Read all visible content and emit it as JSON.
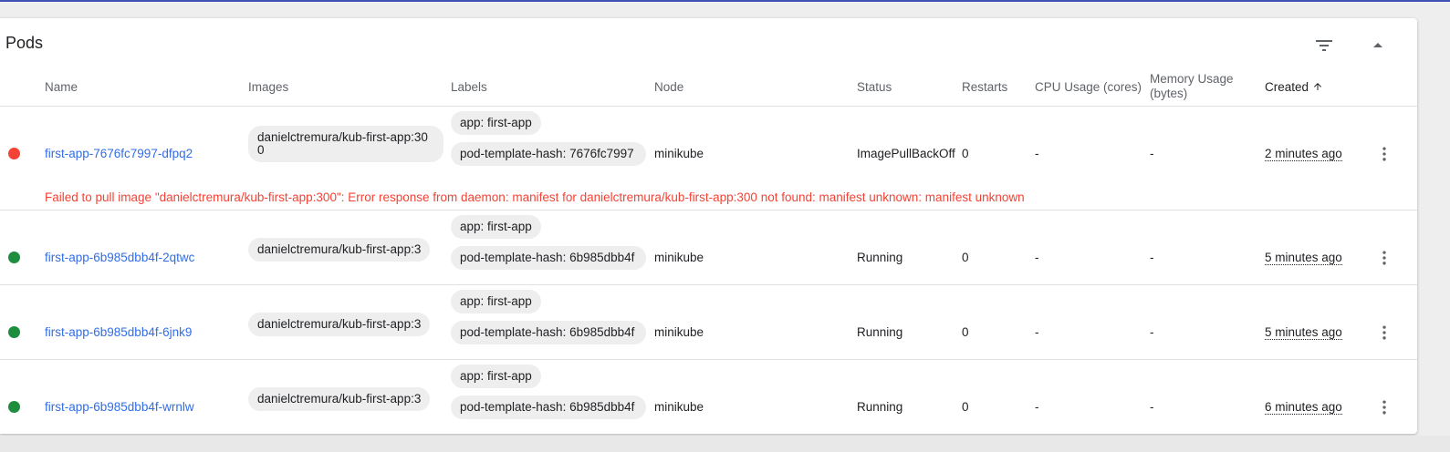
{
  "card": {
    "title": "Pods"
  },
  "columns": {
    "name": "Name",
    "images": "Images",
    "labels": "Labels",
    "node": "Node",
    "status": "Status",
    "restarts": "Restarts",
    "cpu": "CPU Usage (cores)",
    "memory_line1": "Memory Usage",
    "memory_line2": "(bytes)",
    "created": "Created"
  },
  "icons": {
    "filter": "filter-list-icon",
    "collapse": "arrow-drop-up-icon",
    "sort": "arrow-upward-icon",
    "menu": "more-vert-icon"
  },
  "colors": {
    "error": "#f44336",
    "running": "#1e8e3e",
    "link": "#326de6"
  },
  "pods": [
    {
      "status_color": "#f44336",
      "name": "first-app-7676fc7997-dfpq2",
      "image": "danielctremura/kub-first-app:300",
      "labels": [
        "app: first-app",
        "pod-template-hash: 7676fc7997"
      ],
      "node": "minikube",
      "status": "ImagePullBackOff",
      "restarts": "0",
      "cpu": "-",
      "memory": "-",
      "created": "2 minutes ago",
      "error": "Failed to pull image \"danielctremura/kub-first-app:300\": Error response from daemon: manifest for danielctremura/kub-first-app:300 not found: manifest unknown: manifest unknown"
    },
    {
      "status_color": "#1e8e3e",
      "name": "first-app-6b985dbb4f-2qtwc",
      "image": "danielctremura/kub-first-app:3",
      "labels": [
        "app: first-app",
        "pod-template-hash: 6b985dbb4f"
      ],
      "node": "minikube",
      "status": "Running",
      "restarts": "0",
      "cpu": "-",
      "memory": "-",
      "created": "5 minutes ago"
    },
    {
      "status_color": "#1e8e3e",
      "name": "first-app-6b985dbb4f-6jnk9",
      "image": "danielctremura/kub-first-app:3",
      "labels": [
        "app: first-app",
        "pod-template-hash: 6b985dbb4f"
      ],
      "node": "minikube",
      "status": "Running",
      "restarts": "0",
      "cpu": "-",
      "memory": "-",
      "created": "5 minutes ago"
    },
    {
      "status_color": "#1e8e3e",
      "name": "first-app-6b985dbb4f-wrnlw",
      "image": "danielctremura/kub-first-app:3",
      "labels": [
        "app: first-app",
        "pod-template-hash: 6b985dbb4f"
      ],
      "node": "minikube",
      "status": "Running",
      "restarts": "0",
      "cpu": "-",
      "memory": "-",
      "created": "6 minutes ago"
    }
  ]
}
